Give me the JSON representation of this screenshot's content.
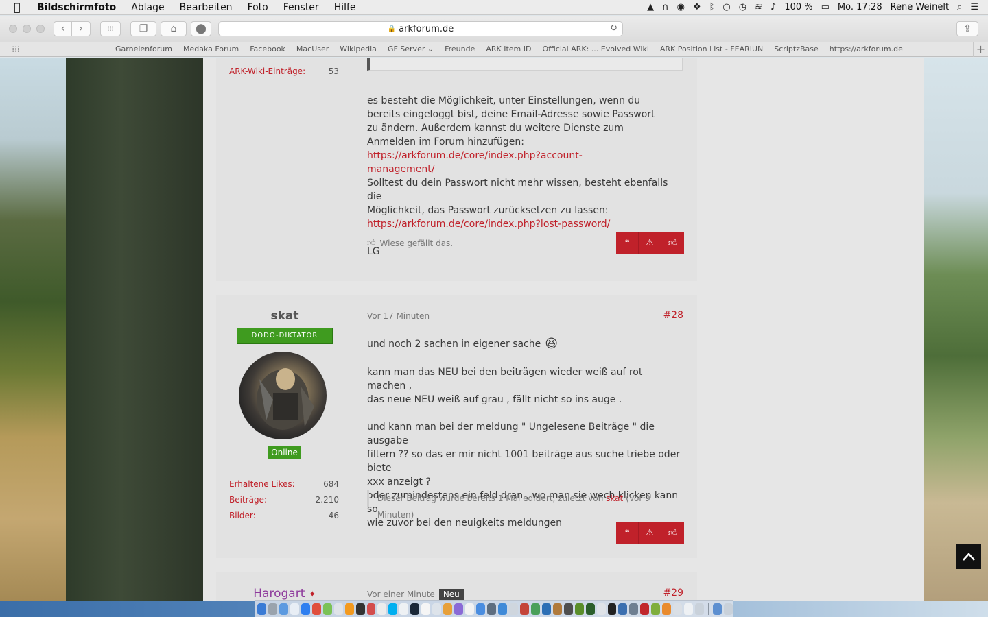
{
  "menubar": {
    "app_name": "Bildschirmfoto",
    "menus": [
      "Ablage",
      "Bearbeiten",
      "Foto",
      "Fenster",
      "Hilfe"
    ],
    "battery": "100 %",
    "clock": "Mo. 17:28",
    "user": "Rene Weinelt"
  },
  "browser": {
    "url": "arkforum.de",
    "bookmarks": [
      "Garnelenforum",
      "Medaka Forum",
      "Facebook",
      "MacUser",
      "Wikipedia",
      "GF Server ⌄",
      "Freunde",
      "ARK Item ID",
      "Official ARK: ... Evolved Wiki",
      "ARK Position List - FEARIUN",
      "ScriptzBase",
      "https://arkforum.de"
    ]
  },
  "post_prev": {
    "stat_label": "ARK-Wiki-Einträge:",
    "stat_value": "53",
    "paragraph": "es besteht die Möglichkeit, unter Einstellungen, wenn du bereits eingeloggt bist, deine Email-Adresse sowie Passwort zu ändern. Außerdem kannst du weitere Dienste zum Anmelden im Forum hinzufügen:",
    "link1_a": "https://arkforum.de/core/index.php?account-",
    "link1_b": "management/",
    "para2_a": "Solltest du dein Passwort nicht mehr wissen, besteht ebenfalls die",
    "para2_b": "Möglichkeit, das Passwort zurücksetzen zu lassen:",
    "link2": "https://arkforum.de/core/index.php?lost-password/",
    "sign": "LG",
    "likes": "Wiese gefällt das."
  },
  "post_28": {
    "username": "skat",
    "rank": "DODO-DIKTATOR",
    "status": "Online",
    "stats": [
      {
        "label": "Erhaltene Likes:",
        "value": "684"
      },
      {
        "label": "Beiträge:",
        "value": "2.210"
      },
      {
        "label": "Bilder:",
        "value": "46"
      }
    ],
    "time": "Vor 17 Minuten",
    "number": "#28",
    "line1": "und noch 2 sachen in eigener sache",
    "emoji": "😆",
    "line2a": "kann man das NEU bei den beiträgen wieder weiß auf rot machen ,",
    "line2b": "das neue NEU weiß auf grau , fällt nicht so ins auge .",
    "line3a": "und kann man bei der meldung \" Ungelesene Beiträge \" die ausgabe",
    "line3b": "filtern ?? so das er mir nicht 1001 beiträge aus suche triebe oder biete",
    "line3c": "xxx anzeigt ?",
    "line4a": "oder zumindestens ein feld dran , wo man sie wech klicken kann so",
    "line4b": "wie zuvor bei den neuigkeits meldungen",
    "edit_prefix": "Dieser Beitrag wurde bereits 1 Mal editiert, zuletzt von",
    "edit_user": "skat",
    "edit_suffix": "(Vor 9 Minuten)"
  },
  "post_29": {
    "username": "Harogart",
    "time": "Vor einer Minute",
    "new_badge": "Neu",
    "number": "#29"
  },
  "icons": {
    "quote": "quote-icon",
    "report": "warning-icon",
    "like": "thumbs-up-icon",
    "scroll_top": "chevron-up-icon"
  },
  "colors": {
    "accent": "#c0212a",
    "online": "#3f9b1f"
  }
}
